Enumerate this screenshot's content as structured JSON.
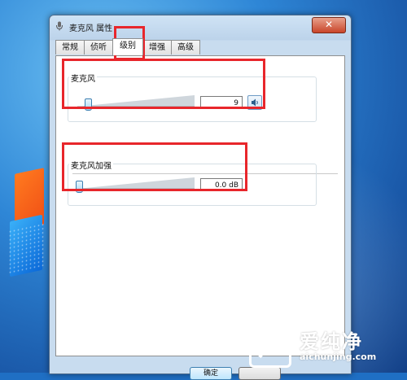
{
  "window": {
    "title": "麦克风 属性",
    "close_glyph": "✕"
  },
  "tabs": [
    {
      "label": "常规"
    },
    {
      "label": "侦听"
    },
    {
      "label": "级别",
      "selected": true
    },
    {
      "label": "增强"
    },
    {
      "label": "高级"
    }
  ],
  "microphone": {
    "label": "麦克风",
    "value": "9",
    "level_fraction": 0.09,
    "icon": "speaker-icon"
  },
  "boost": {
    "label": "麦克风加强",
    "value": "0.0 dB",
    "level_fraction": 0.0
  },
  "buttons": {
    "ok": "确定"
  },
  "watermark": {
    "text_zh": "爱纯净",
    "url": "aichunjing.com"
  },
  "colors": {
    "annotation": "#e8262b",
    "thumb_border": "#3c7fb1"
  }
}
